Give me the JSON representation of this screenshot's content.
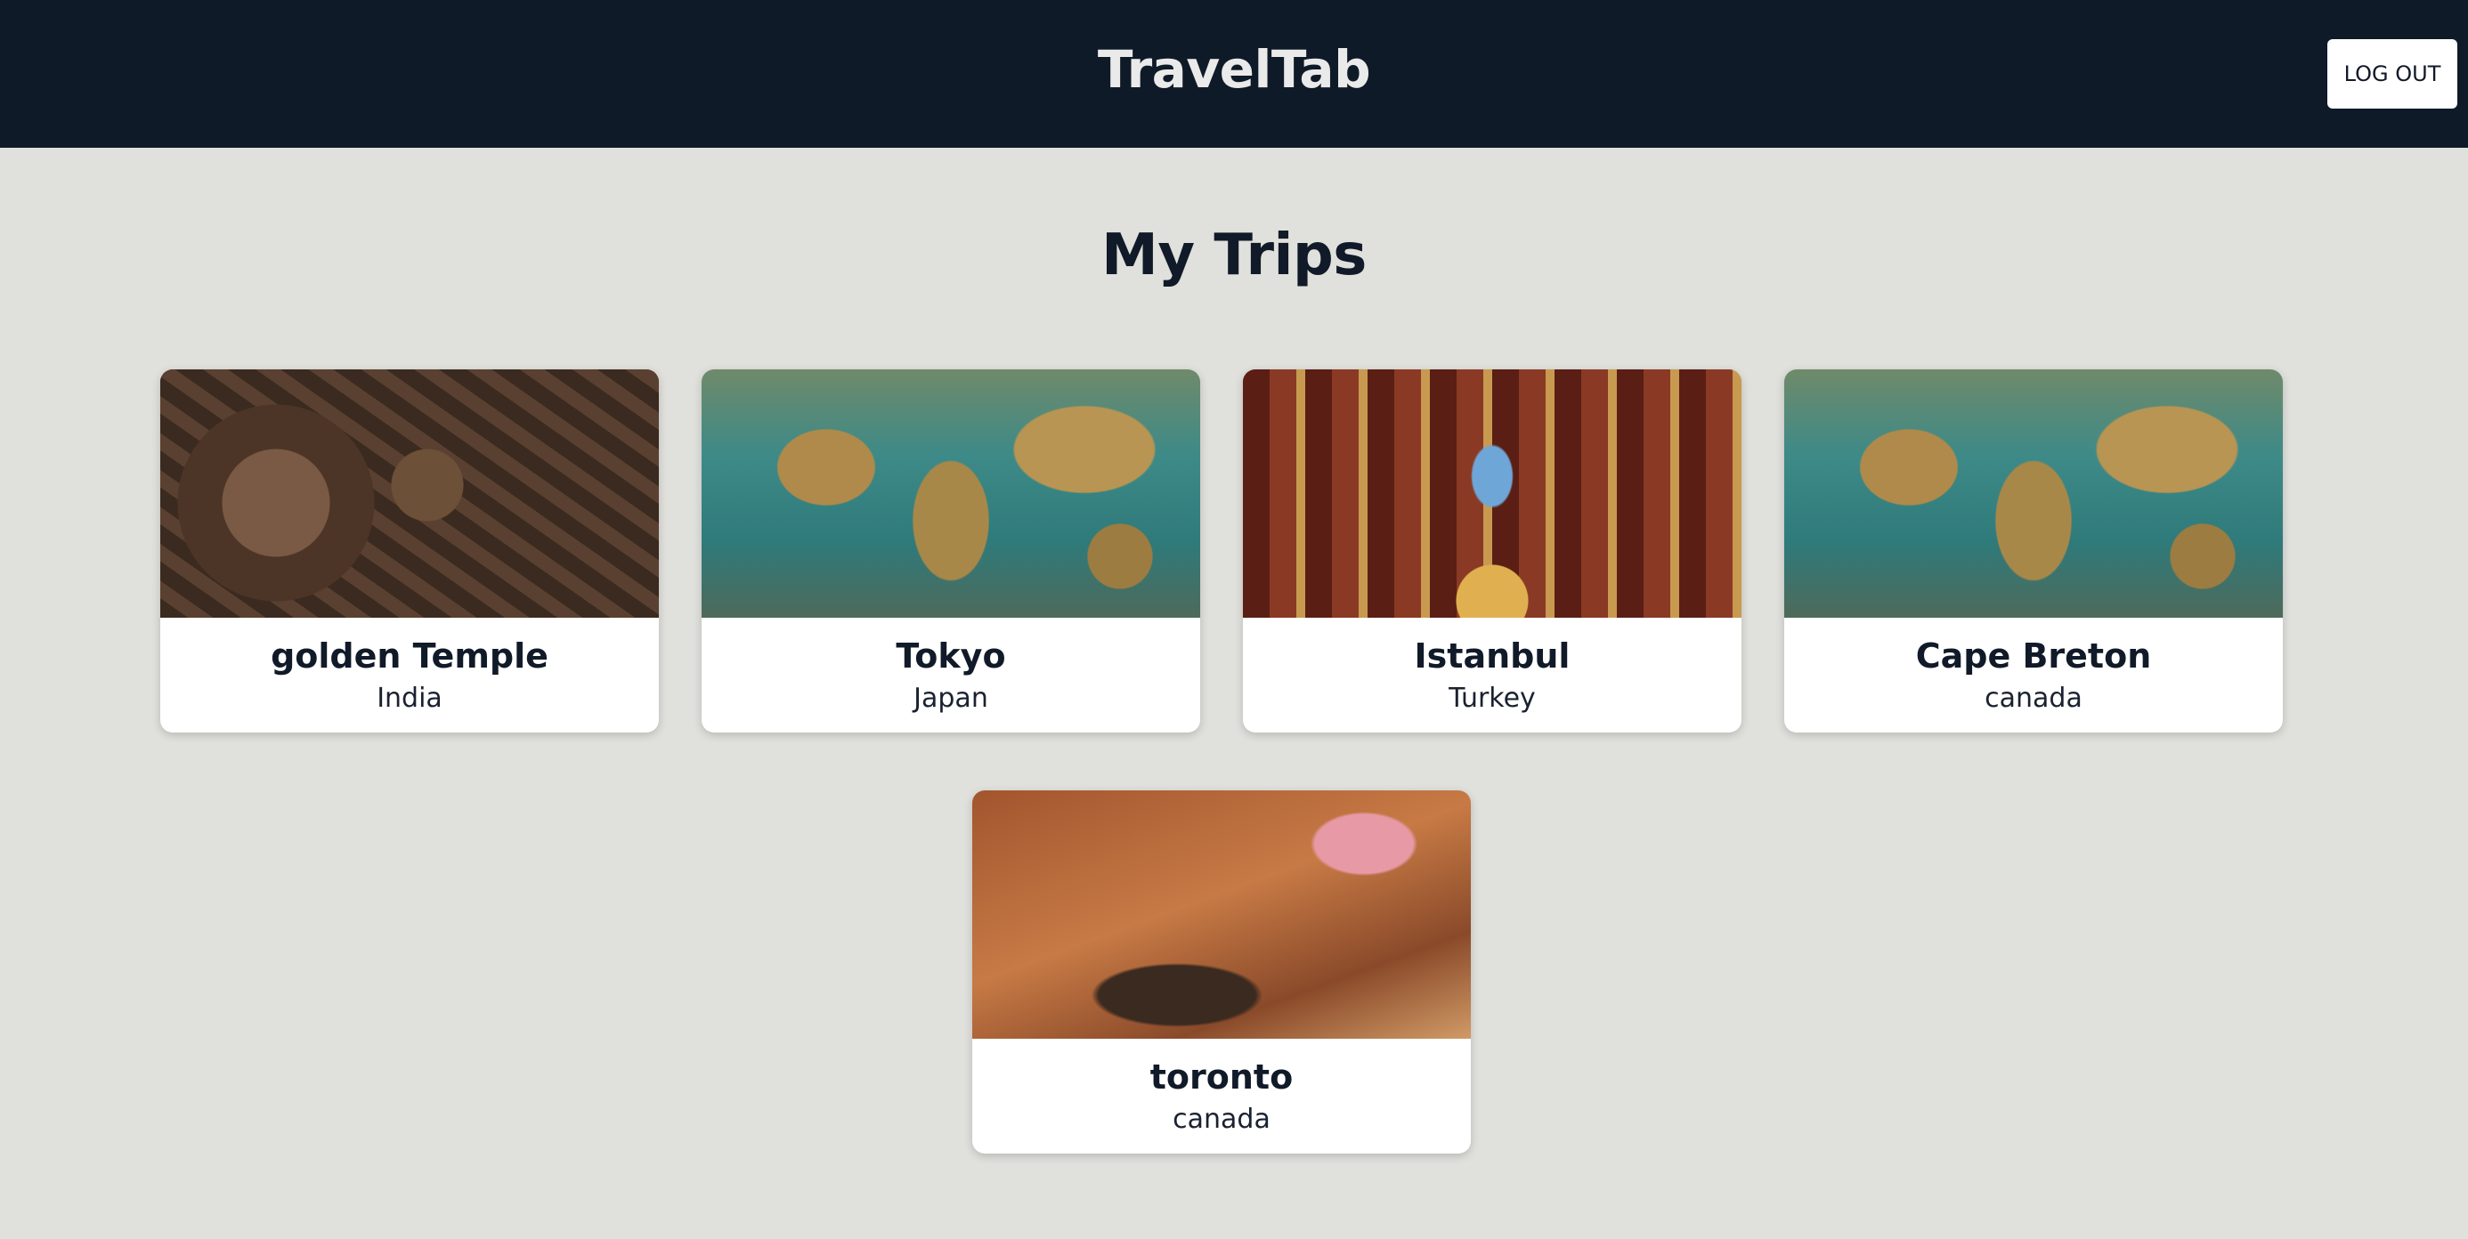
{
  "header": {
    "brand": "TravelTab",
    "logout_label": "LOG OUT"
  },
  "main": {
    "title": "My Trips",
    "trips": [
      {
        "name": "golden Temple",
        "country": "India"
      },
      {
        "name": "Tokyo",
        "country": "Japan"
      },
      {
        "name": "Istanbul",
        "country": "Turkey"
      },
      {
        "name": "Cape Breton",
        "country": "canada"
      },
      {
        "name": "toronto",
        "country": "canada"
      }
    ]
  },
  "colors": {
    "header_bg": "#0f1a28",
    "page_bg": "#e0e0dc",
    "card_bg": "#ffffff",
    "text": "#111a28"
  }
}
